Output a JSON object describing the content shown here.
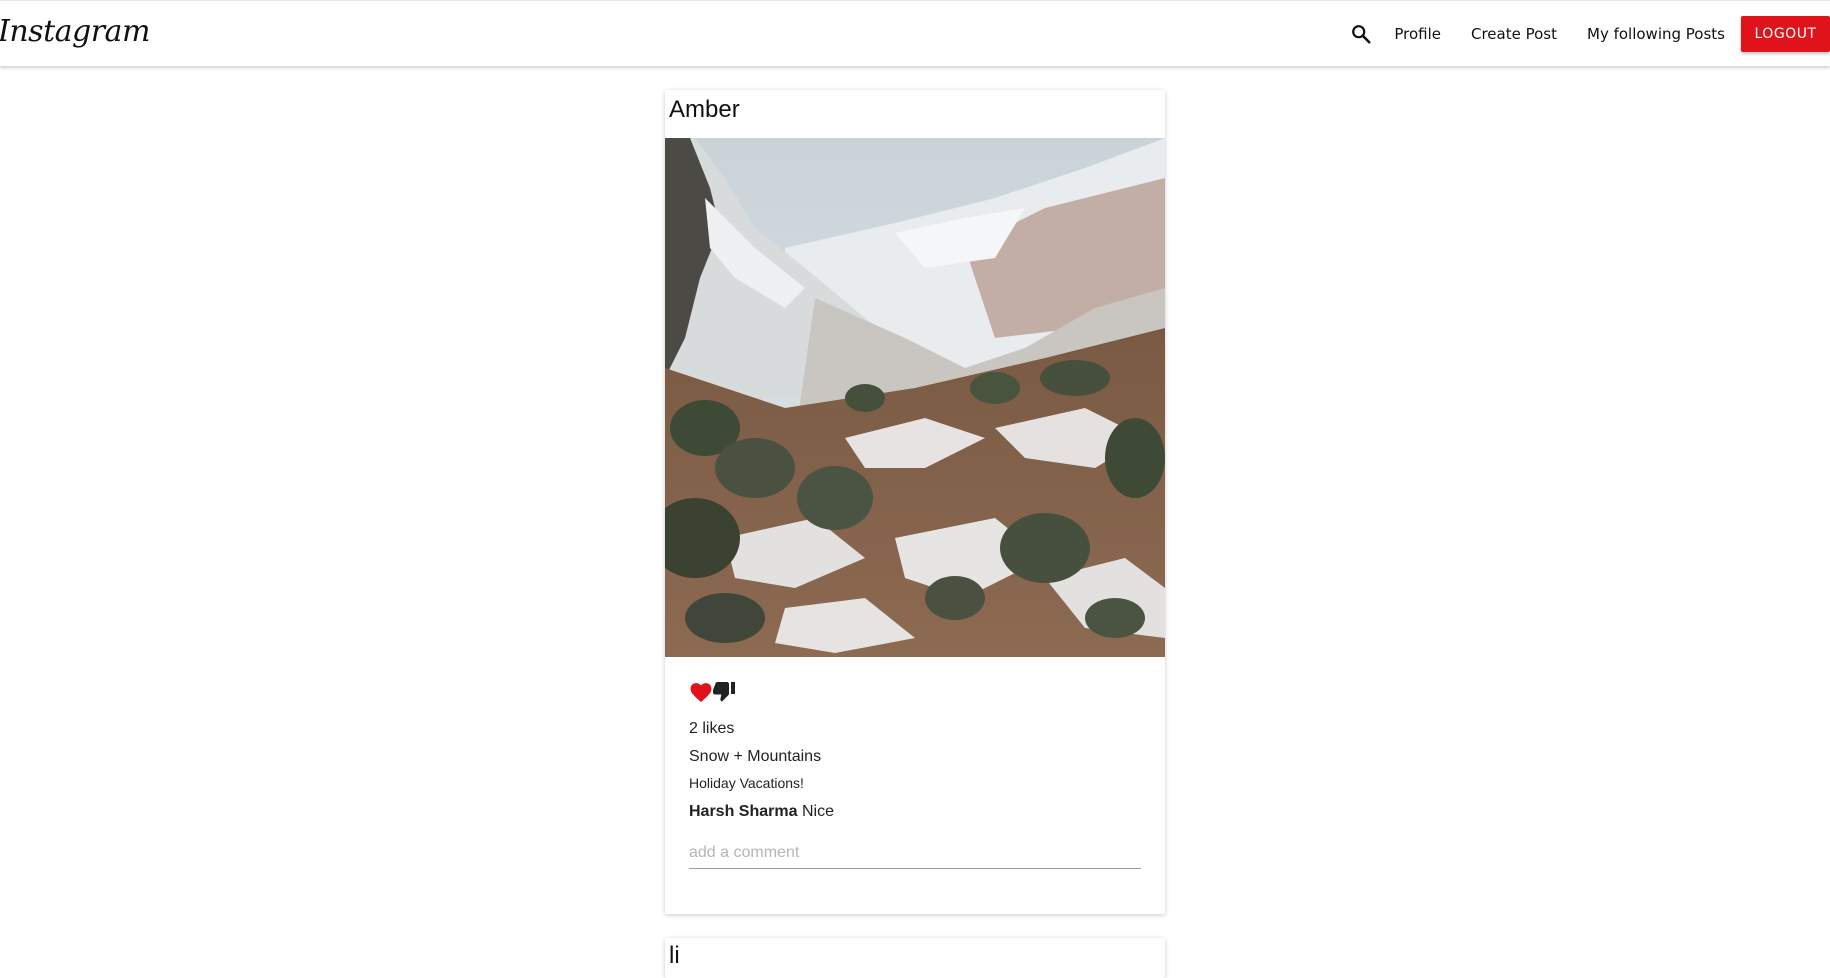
{
  "navbar": {
    "brand": "Instagram",
    "search_icon": "search-icon",
    "links": {
      "profile": "Profile",
      "create_post": "Create Post",
      "following_posts": "My following Posts"
    },
    "logout_label": "LOGOUT",
    "logout_color": "#e0131a"
  },
  "post": {
    "author": "Amber",
    "like_icon": "heart-icon",
    "like_color": "#e0131a",
    "dislike_icon": "thumbs-down-icon",
    "likes_text": "2 likes",
    "title": "Snow + Mountains",
    "body": "Holiday Vacations!",
    "comments": [
      {
        "user": "Harsh Sharma",
        "text": "Nice"
      }
    ],
    "comment_placeholder": "add a comment"
  },
  "next_post": {
    "author": "li"
  }
}
